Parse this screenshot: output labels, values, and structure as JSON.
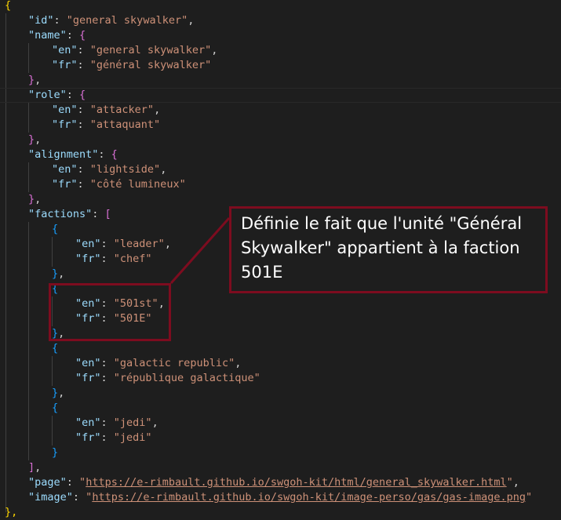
{
  "json": {
    "open_brace": "{",
    "id_key": "\"id\"",
    "id_val": "\"general skywalker\"",
    "name_key": "\"name\"",
    "name_en_key": "\"en\"",
    "name_en": "\"general skywalker\"",
    "name_fr_key": "\"fr\"",
    "name_fr": "\"général skywalker\"",
    "role_key": "\"role\"",
    "role_en_key": "\"en\"",
    "role_en": "\"attacker\"",
    "role_fr_key": "\"fr\"",
    "role_fr": "\"attaquant\"",
    "align_key": "\"alignment\"",
    "align_en_key": "\"en\"",
    "align_en": "\"lightside\"",
    "align_fr_key": "\"fr\"",
    "align_fr": "\"côté lumineux\"",
    "factions_key": "\"factions\"",
    "f1_en_key": "\"en\"",
    "f1_en": "\"leader\"",
    "f1_fr_key": "\"fr\"",
    "f1_fr": "\"chef\"",
    "f2_en_key": "\"en\"",
    "f2_en": "\"501st\"",
    "f2_fr_key": "\"fr\"",
    "f2_fr": "\"501E\"",
    "f3_en_key": "\"en\"",
    "f3_en": "\"galactic republic\"",
    "f3_fr_key": "\"fr\"",
    "f3_fr": "\"république galactique\"",
    "f4_en_key": "\"en\"",
    "f4_en": "\"jedi\"",
    "f4_fr_key": "\"fr\"",
    "f4_fr": "\"jedi\"",
    "page_key": "\"page\"",
    "page_q1": "\"",
    "page_url": "https://e-rimbault.github.io/swgoh-kit/html/general_skywalker.html",
    "page_q2": "\"",
    "image_key": "\"image\"",
    "image_q1": "\"",
    "image_url": "https://e-rimbault.github.io/swgoh-kit/image-perso/gas/gas-image.png",
    "image_q2": "\"",
    "close_brace": "},"
  },
  "annotation": {
    "text": "Définie le fait que l'unité \"Général Skywalker\" appartient à la faction 501E",
    "border_color": "#7d0c1f"
  },
  "colors": {
    "background": "#1e1e1e",
    "key": "#9cdcfe",
    "string": "#ce9178",
    "bracket_level1": "#ffd700",
    "bracket_level2": "#da70d6",
    "bracket_level3": "#179fff"
  }
}
